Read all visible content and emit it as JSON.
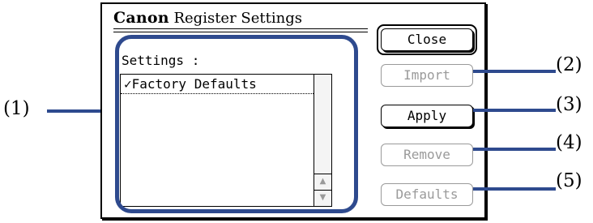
{
  "dialog": {
    "brand": "Canon",
    "title": "Register Settings",
    "settings_label": "Settings :",
    "list_items": [
      "✓Factory Defaults"
    ]
  },
  "buttons": {
    "close": "Close",
    "import": "Import",
    "apply": "Apply",
    "remove": "Remove",
    "defaults": "Defaults"
  },
  "scroll": {
    "up_icon": "▲",
    "down_icon": "▼"
  },
  "callouts": {
    "c1": "(1)",
    "c2": "(2)",
    "c3": "(3)",
    "c4": "(4)",
    "c5": "(5)"
  },
  "colors": {
    "callout": "#2e4a8e",
    "disabled": "#9a9a9a"
  }
}
